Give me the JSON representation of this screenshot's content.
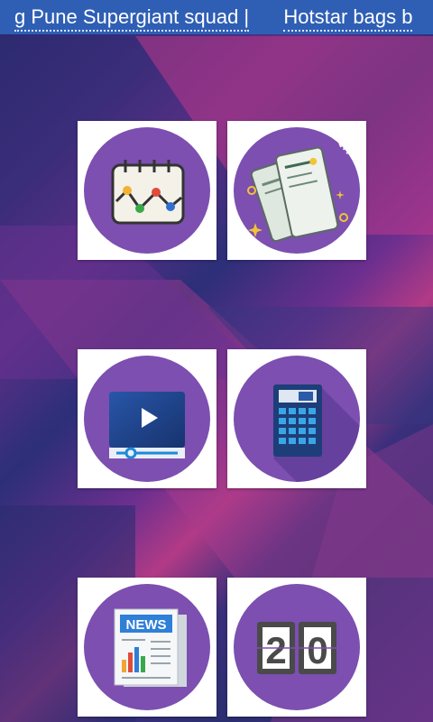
{
  "ticker": {
    "items": [
      "g Pune Supergiant squad |",
      "Hotstar bags b"
    ]
  },
  "tiles": [
    {
      "icon": "chart-calendar-icon"
    },
    {
      "icon": "tickets-icon"
    },
    {
      "icon": "video-player-icon"
    },
    {
      "icon": "calculator-icon"
    },
    {
      "icon": "news-icon",
      "label": "NEWS"
    },
    {
      "icon": "scoreboard-icon",
      "score_left": "2",
      "score_right": "0"
    }
  ],
  "colors": {
    "ticker_bg": "#2f5fb5",
    "circle": "#7c4fb0",
    "tile_bg": "#ffffff"
  }
}
